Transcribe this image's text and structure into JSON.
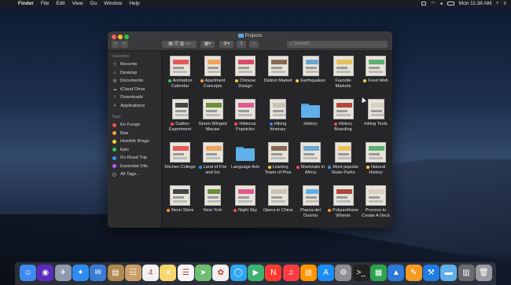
{
  "menubar": {
    "apple": "",
    "items": [
      "Finder",
      "File",
      "Edit",
      "View",
      "Go",
      "Window",
      "Help"
    ],
    "clock": "Mon 11:38 AM"
  },
  "window": {
    "title": "Projects",
    "search_placeholder": "Search"
  },
  "sidebar": {
    "favorites_header": "Favorites",
    "favorites": [
      {
        "label": "Recents",
        "icon": "clock-icon"
      },
      {
        "label": "Desktop",
        "icon": "desktop-icon"
      },
      {
        "label": "Documents",
        "icon": "document-icon"
      },
      {
        "label": "iCloud Drive",
        "icon": "cloud-icon"
      },
      {
        "label": "Downloads",
        "icon": "download-icon"
      },
      {
        "label": "Applications",
        "icon": "applications-icon"
      }
    ],
    "tags_header": "Tags",
    "tags": [
      {
        "label": "En Fuego",
        "color": "#ff4d4d"
      },
      {
        "label": "Bae",
        "color": "#ff9a3c"
      },
      {
        "label": "Humble Brags",
        "color": "#ffd23c"
      },
      {
        "label": "Epic",
        "color": "#36c55a"
      },
      {
        "label": "It's Road Trip",
        "color": "#3a8cff"
      },
      {
        "label": "Essential Oils",
        "color": "#b05cff"
      },
      {
        "label": "All Tags...",
        "color": "#8e8e93"
      }
    ]
  },
  "files": [
    {
      "line1": "Animation",
      "line2": "Calendar",
      "tag": "#36c55a"
    },
    {
      "line1": "Apartment",
      "line2": "Concepts",
      "tag": "#ff9a3c"
    },
    {
      "line1": "Chinese",
      "line2": "Design",
      "tag": "#ffd23c"
    },
    {
      "line1": "District Market",
      "line2": "",
      "tag": ""
    },
    {
      "line1": "Earthquakes",
      "line2": "",
      "tag": "#ffd23c"
    },
    {
      "line1": "Favorite",
      "line2": "Markets",
      "tag": ""
    },
    {
      "line1": "Food Web",
      "line2": "",
      "tag": "#ffd23c"
    },
    {
      "line1": "Galileo",
      "line2": "Experiment",
      "tag": "#ff4d4d"
    },
    {
      "line1": "Green Winged",
      "line2": "Macaw",
      "tag": ""
    },
    {
      "line1": "Hibiscus",
      "line2": "Popsicles",
      "tag": "#ff4d4d"
    },
    {
      "line1": "Hiking",
      "line2": "Itinerary",
      "tag": "#3a8cff"
    },
    {
      "line1": "History",
      "line2": "",
      "tag": ""
    },
    {
      "line1": "History",
      "line2": "Boarding",
      "tag": "#ff4d4d"
    },
    {
      "line1": "Inking Tools",
      "line2": "",
      "tag": ""
    },
    {
      "line1": "Kitchen College",
      "line2": "",
      "tag": ""
    },
    {
      "line1": "Land of Fire",
      "line2": "and Ice",
      "tag": "#3a8cff"
    },
    {
      "line1": "Language Arts",
      "line2": "",
      "tag": ""
    },
    {
      "line1": "Leaning",
      "line2": "Tower of Pisa",
      "tag": "#ffd23c"
    },
    {
      "line1": "Mammals in",
      "line2": "Africa",
      "tag": "#ff4d4d"
    },
    {
      "line1": "Most popular",
      "line2": "Skate Parks",
      "tag": "#3a8cff"
    },
    {
      "line1": "Natural",
      "line2": "History",
      "tag": "#ffd23c"
    },
    {
      "line1": "Neon Skies",
      "line2": "",
      "tag": "#ff9a3c"
    },
    {
      "line1": "New York",
      "line2": "",
      "tag": ""
    },
    {
      "line1": "Night Sky",
      "line2": "",
      "tag": "#ff4d4d"
    },
    {
      "line1": "Opera in China",
      "line2": "",
      "tag": ""
    },
    {
      "line1": "Piazza del",
      "line2": "Duomo",
      "tag": ""
    },
    {
      "line1": "Polyurethane",
      "line2": "Wheels",
      "tag": "#ff9a3c"
    },
    {
      "line1": "Process to",
      "line2": "Create A Deck",
      "tag": ""
    }
  ],
  "dock": {
    "apps": [
      {
        "name": "finder-icon",
        "color": "#3d8bf0",
        "glyph": "☺"
      },
      {
        "name": "siri-icon",
        "color": "#5b2bbd",
        "glyph": "◉"
      },
      {
        "name": "launchpad-icon",
        "color": "#8d9ab0",
        "glyph": "✈"
      },
      {
        "name": "safari-icon",
        "color": "#2d8cf0",
        "glyph": "✦"
      },
      {
        "name": "mail-icon",
        "color": "#3a7bd5",
        "glyph": "✉"
      },
      {
        "name": "notes-book-icon",
        "color": "#b08850",
        "glyph": "▤"
      },
      {
        "name": "contacts-icon",
        "color": "#c9a06a",
        "glyph": "☷"
      },
      {
        "name": "calendar-icon",
        "color": "#f2f2f2",
        "glyph": "4"
      },
      {
        "name": "notes-icon",
        "color": "#f5d76e",
        "glyph": "≡"
      },
      {
        "name": "reminders-icon",
        "color": "#f5f5f5",
        "glyph": "☰"
      },
      {
        "name": "maps-icon",
        "color": "#6fbf73",
        "glyph": "➤"
      },
      {
        "name": "photos-icon",
        "color": "#f0f0f0",
        "glyph": "✿"
      },
      {
        "name": "messages-icon",
        "color": "#2ea6f5",
        "glyph": "◯"
      },
      {
        "name": "facetime-icon",
        "color": "#3cb371",
        "glyph": "▶"
      },
      {
        "name": "news-icon",
        "color": "#ff3b30",
        "glyph": "N"
      },
      {
        "name": "music-icon",
        "color": "#fc3c44",
        "glyph": "♫"
      },
      {
        "name": "books-icon",
        "color": "#ff9500",
        "glyph": "▥"
      },
      {
        "name": "app-store-icon",
        "color": "#1c8df5",
        "glyph": "A"
      },
      {
        "name": "system-preferences-icon",
        "color": "#8e8e93",
        "glyph": "⚙"
      },
      {
        "name": "terminal-icon",
        "color": "#222",
        "glyph": ">_"
      },
      {
        "name": "numbers-icon",
        "color": "#2ea44f",
        "glyph": "▦"
      },
      {
        "name": "keynote-icon",
        "color": "#2b79d8",
        "glyph": "▲"
      },
      {
        "name": "pages-icon",
        "color": "#f59a23",
        "glyph": "✎"
      },
      {
        "name": "xcode-icon",
        "color": "#1f7de0",
        "glyph": "⚒"
      },
      {
        "name": "folder-icon",
        "color": "#5fb0ea",
        "glyph": "▬"
      },
      {
        "name": "downloads-stack-icon",
        "color": "#6a6a70",
        "glyph": "▥"
      },
      {
        "name": "trash-icon",
        "color": "#9a9aa0",
        "glyph": "🗑"
      }
    ]
  }
}
